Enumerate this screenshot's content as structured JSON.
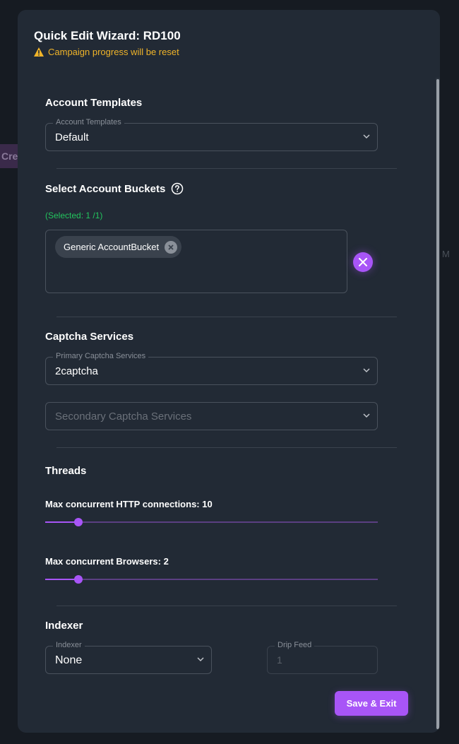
{
  "background": {
    "tab_partial": "Cre",
    "side_text": "M"
  },
  "dialog": {
    "title": "Quick Edit Wizard: RD100",
    "warning": "Campaign progress will be reset"
  },
  "account_templates": {
    "section_title": "Account Templates",
    "field_label": "Account Templates",
    "value": "Default"
  },
  "account_buckets": {
    "section_title": "Select Account Buckets",
    "selected_count": "(Selected: 1 /1)",
    "chips": [
      "Generic AccountBucket"
    ]
  },
  "captcha": {
    "section_title": "Captcha Services",
    "primary_label": "Primary Captcha Services",
    "primary_value": "2captcha",
    "secondary_placeholder": "Secondary Captcha Services"
  },
  "threads": {
    "section_title": "Threads",
    "http_label": "Max concurrent HTTP connections: 10",
    "http_value": 10,
    "http_max": 100,
    "browser_label": "Max concurrent Browsers: 2",
    "browser_value": 2,
    "browser_max": 20
  },
  "indexer": {
    "section_title": "Indexer",
    "field_label": "Indexer",
    "value": "None",
    "drip_label": "Drip Feed",
    "drip_value": "1"
  },
  "actions": {
    "save_label": "Save & Exit"
  },
  "colors": {
    "accent": "#a855f7",
    "warning": "#f0b429",
    "success": "#22c55e",
    "dialog_bg": "#222a35"
  }
}
